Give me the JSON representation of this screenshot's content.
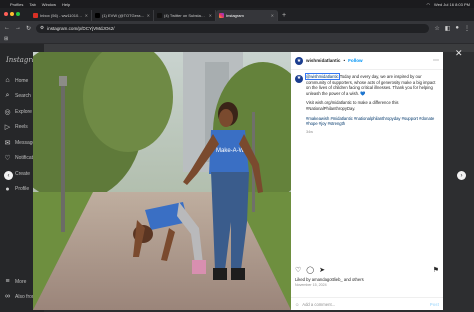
{
  "menubar": {
    "items": [
      "Profiles",
      "Tab",
      "Window",
      "Help"
    ],
    "datetime": "Wed Jul 16  8:03 PM"
  },
  "tabs": [
    {
      "label": "Inbox (56) - ww11010@gmai",
      "color": "#d93025"
    },
    {
      "label": "(1) EVW (@TOTGerant) / X",
      "color": "#000000"
    },
    {
      "label": "(4) Twitter on Substack _",
      "color": "#111111"
    },
    {
      "label": "Instagram",
      "color": "#e1306c"
    }
  ],
  "toolbar": {
    "url": "instagram.com/p/DCYjVMdJOs2/"
  },
  "sidebar": {
    "logo": "Instagram",
    "items": [
      {
        "label": "Home",
        "icon": "home-icon",
        "glyph": "⌂"
      },
      {
        "label": "Search",
        "icon": "search-icon",
        "glyph": "⌕"
      },
      {
        "label": "Explore",
        "icon": "explore-icon",
        "glyph": "◎"
      },
      {
        "label": "Reels",
        "icon": "reels-icon",
        "glyph": "▷"
      },
      {
        "label": "Messages",
        "icon": "messages-icon",
        "glyph": "✉"
      },
      {
        "label": "Notifications",
        "icon": "heart-icon",
        "glyph": "♡"
      },
      {
        "label": "Create",
        "icon": "plus-icon",
        "glyph": "⊕"
      },
      {
        "label": "Profile",
        "icon": "profile-icon",
        "glyph": "●"
      }
    ],
    "more": "More",
    "also_from": "Also from"
  },
  "post": {
    "username": "wishmidatlantic",
    "follow": "Follow",
    "mention": "@wishmidatlantic",
    "caption_1": "Today and every day, we are inspired by our community of supporters, whose acts of generosity make a big impact on the lives of children facing critical illnesses. Thank you for helping unleash the power of a wish. 💙",
    "caption_2": "Visit wish.org/midatlantic to make a difference this #NationalPhilanthropyDay.",
    "caption_3": "#makeawish #midatlantic #nationalphilanthropyday #support #donate #hope #joy #strength",
    "caption_time": "34w",
    "likes": "Liked by amandagottlieb_ and others",
    "date": "November 15, 2024",
    "comment_placeholder": "Add a comment...",
    "post_label": "Post",
    "shirt_text": "Make-A-Wish"
  },
  "colors": {
    "accent": "#0095f6",
    "shirt": "#3a6fc4"
  }
}
